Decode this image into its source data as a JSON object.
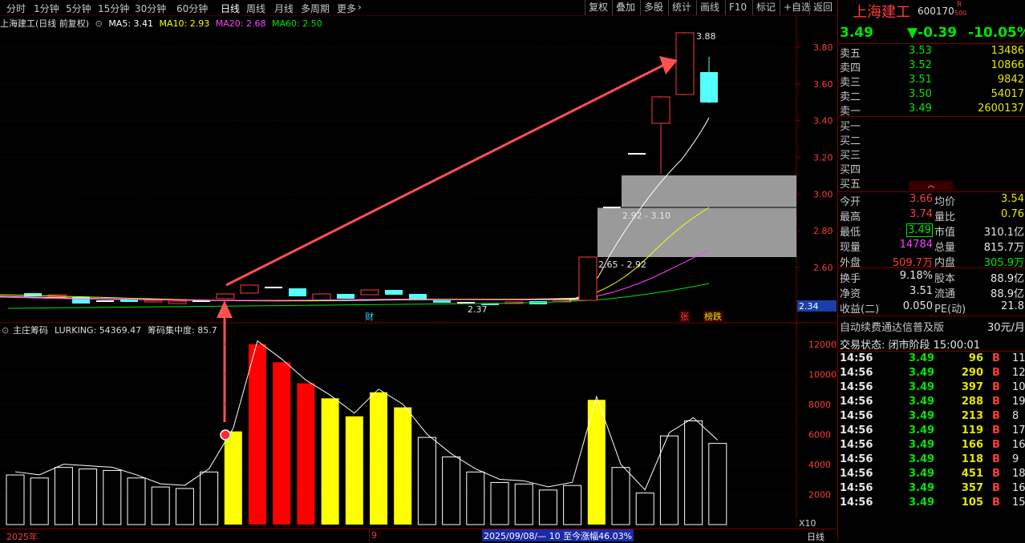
{
  "toolbar": {
    "periods": [
      "分时",
      "1分钟",
      "5分钟",
      "15分钟",
      "30分钟",
      "60分钟",
      "日线",
      "周线",
      "月线",
      "多周期",
      "更多"
    ],
    "active_period": "日线",
    "right_buttons": [
      "复权",
      "叠加",
      "多股",
      "统计",
      "画线",
      "F10",
      "标记",
      "+自选",
      "返回"
    ]
  },
  "kline": {
    "title": "上海建工(日线 前复权)",
    "ma5": "MA5: 3.41",
    "ma10": "MA10: 2.93",
    "ma20": "MA20: 2.68",
    "ma60": "MA60: 2.50",
    "price_axis": [
      "3.80",
      "3.60",
      "3.40",
      "3.20",
      "3.00",
      "2.80",
      "2.60"
    ],
    "price_tag": "2.34",
    "high_label": "3.88",
    "low_label": "2.37",
    "zone_upper_label": "2.92 - 3.10",
    "zone_lower_label": "2.65 - 2.92",
    "marker_cai": "财",
    "marker_zhang": "张",
    "marker_bang": "榜跌"
  },
  "indicator": {
    "name": "主庄筹码",
    "lurking": "LURKING: 54369.47",
    "concentration": "筹码集中度: 85.7",
    "axis": [
      "12000",
      "10000",
      "8000",
      "6000",
      "4000",
      "2000"
    ],
    "axis_unit": "X10"
  },
  "bottombar": {
    "year": "2025年",
    "month": "9",
    "range_text": "2025/09/08/— 10 至今涨幅46.03%",
    "period": "日线"
  },
  "chart_data": {
    "type": "bar",
    "title": "主庄筹码",
    "ylabel": "",
    "ylim": [
      0,
      13000
    ],
    "values": [
      3300,
      3100,
      3800,
      3700,
      3600,
      3100,
      2500,
      2400,
      3500,
      6200,
      12000,
      10800,
      9400,
      8400,
      7200,
      8800,
      7800,
      5800,
      4500,
      3500,
      2800,
      2700,
      2300,
      2600,
      8300,
      3800,
      2100,
      5900,
      6900,
      5400
    ],
    "colors": [
      "none",
      "none",
      "none",
      "none",
      "none",
      "none",
      "none",
      "none",
      "none",
      "yellow",
      "red",
      "red",
      "red",
      "yellow",
      "yellow",
      "yellow",
      "yellow",
      "none",
      "none",
      "none",
      "none",
      "none",
      "none",
      "none",
      "yellow",
      "none",
      "none",
      "none",
      "none",
      "none"
    ]
  },
  "quote": {
    "name": "上海建工",
    "code": "600170",
    "badge_r": "R",
    "badge_500": "500",
    "price": "3.49",
    "change": "▼-0.39",
    "pct": "-10.05%",
    "sells": [
      {
        "label": "卖五",
        "price": "3.53",
        "vol": "13486"
      },
      {
        "label": "卖四",
        "price": "3.52",
        "vol": "10866"
      },
      {
        "label": "卖三",
        "price": "3.51",
        "vol": "9842"
      },
      {
        "label": "卖二",
        "price": "3.50",
        "vol": "54017"
      },
      {
        "label": "卖一",
        "price": "3.49",
        "vol": "2600137"
      }
    ],
    "buys": [
      "买一",
      "买二",
      "买三",
      "买四",
      "买五"
    ],
    "stats": [
      {
        "l1": "今开",
        "v1": "3.66",
        "c1": "r",
        "l2": "均价",
        "v2": "3.54",
        "c2": "y"
      },
      {
        "l1": "最高",
        "v1": "3.74",
        "c1": "r",
        "l2": "量比",
        "v2": "0.76",
        "c2": "y"
      },
      {
        "l1": "最低",
        "v1": "3.49",
        "c1": "g",
        "l2": "市值",
        "v2": "310.1亿",
        "c2": "w"
      },
      {
        "l1": "现量",
        "v1": "14784",
        "c1": "m",
        "l2": "总量",
        "v2": "815.7万",
        "c2": "w"
      },
      {
        "l1": "外盘",
        "v1": "509.7万",
        "c1": "r",
        "l2": "内盘",
        "v2": "305.9万",
        "c2": "g"
      }
    ],
    "stats2": [
      {
        "l1": "换手",
        "v1": "9.18%",
        "l2": "股本",
        "v2": "88.9亿"
      },
      {
        "l1": "净资",
        "v1": "3.51",
        "l2": "流通",
        "v2": "88.9亿"
      },
      {
        "l1": "收益(二)",
        "v1": "0.050",
        "l2": "PE(动)",
        "v2": "21.8"
      }
    ],
    "promo": "自动续费通达信普及版",
    "promo_price": "30元/月",
    "status": "交易状态: 闭市阶段 15:00:01",
    "ticks": [
      {
        "t": "14:56",
        "p": "3.49",
        "v": "96",
        "s": "B",
        "n": "11"
      },
      {
        "t": "14:56",
        "p": "3.49",
        "v": "290",
        "s": "B",
        "n": "12"
      },
      {
        "t": "14:56",
        "p": "3.49",
        "v": "397",
        "s": "B",
        "n": "10"
      },
      {
        "t": "14:56",
        "p": "3.49",
        "v": "288",
        "s": "B",
        "n": "19"
      },
      {
        "t": "14:56",
        "p": "3.49",
        "v": "213",
        "s": "B",
        "n": "8"
      },
      {
        "t": "14:56",
        "p": "3.49",
        "v": "119",
        "s": "B",
        "n": "17"
      },
      {
        "t": "14:56",
        "p": "3.49",
        "v": "166",
        "s": "B",
        "n": "16"
      },
      {
        "t": "14:56",
        "p": "3.49",
        "v": "118",
        "s": "B",
        "n": "9"
      },
      {
        "t": "14:56",
        "p": "3.49",
        "v": "451",
        "s": "B",
        "n": "18"
      },
      {
        "t": "14:56",
        "p": "3.49",
        "v": "357",
        "s": "B",
        "n": "16"
      },
      {
        "t": "14:56",
        "p": "3.49",
        "v": "105",
        "s": "B",
        "n": "15"
      }
    ]
  },
  "colors": {
    "up": "#ff3b3b",
    "down": "#54ffff",
    "yellow": "#ffff00",
    "red": "#ff0000",
    "grid": "#7a0000"
  }
}
